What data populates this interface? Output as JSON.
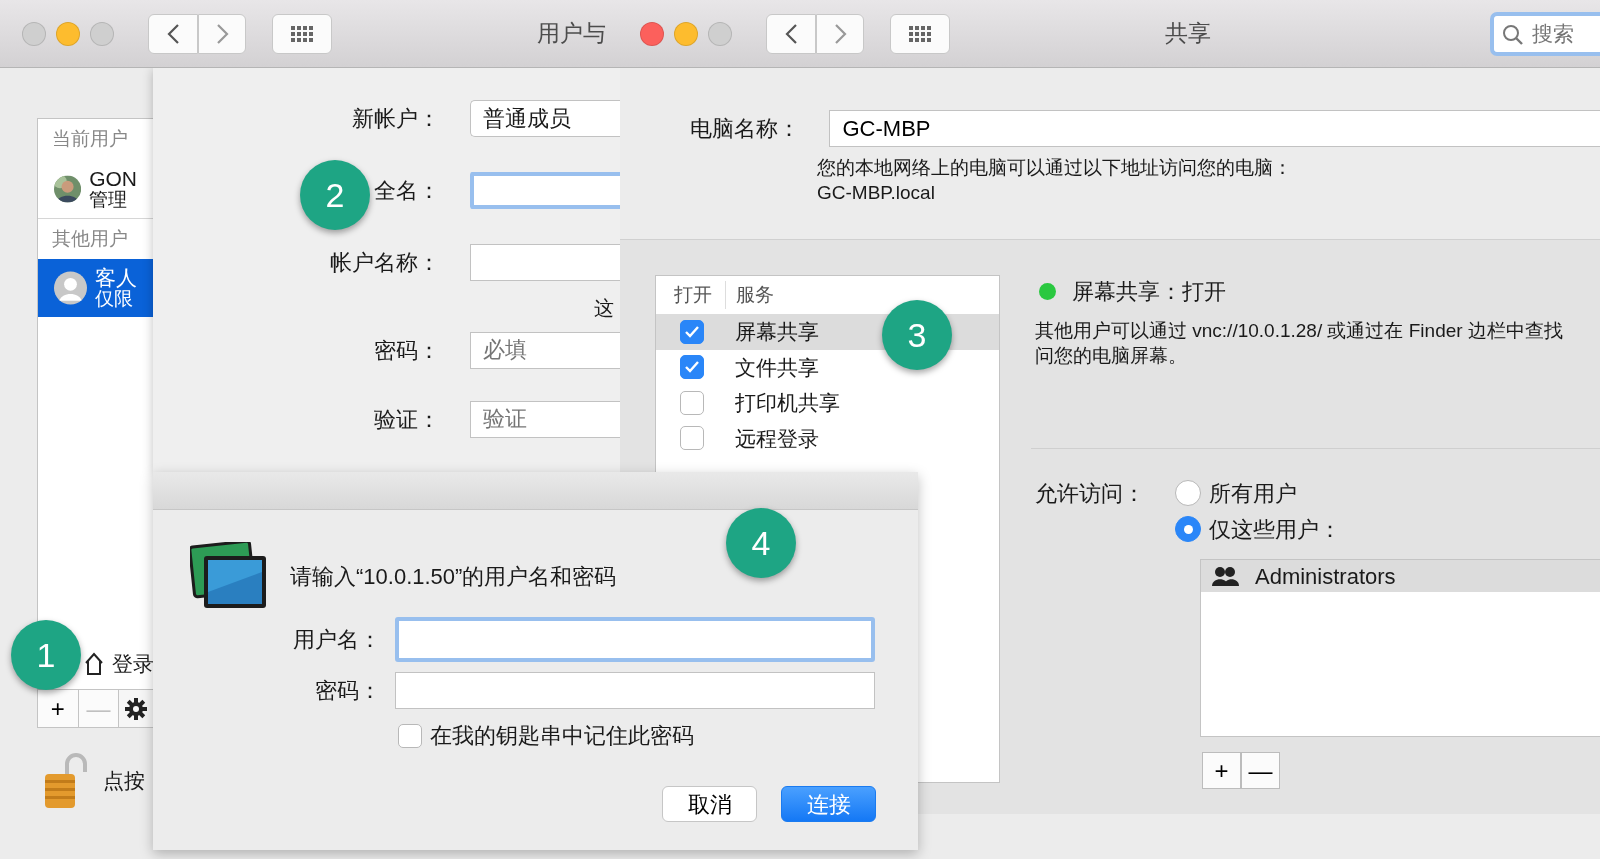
{
  "users_window": {
    "title": "用户与",
    "traffic_lights": [
      {
        "color": "#cfcfcf"
      },
      {
        "color": "#fdbc2e"
      },
      {
        "color": "#cfcfcf"
      }
    ],
    "sidebar": {
      "sections": [
        {
          "header": "当前用户",
          "users": [
            {
              "name": "GON",
              "role": "管理",
              "kind": "photo",
              "selected": false
            }
          ]
        },
        {
          "header": "其他用户",
          "users": [
            {
              "name": "客人",
              "role": "仅限",
              "kind": "generic",
              "selected": true
            }
          ]
        }
      ],
      "login_item": "登录",
      "buttons": [
        {
          "label": "+",
          "disabled": false
        },
        {
          "label": "—",
          "disabled": true
        }
      ]
    },
    "lock_text": "点按",
    "sheet": {
      "fields": [
        {
          "label": "新帐户：",
          "kind": "popup",
          "value": "普通成员"
        },
        {
          "label": "全名：",
          "kind": "text",
          "focused": true
        },
        {
          "label": "帐户名称：",
          "kind": "text",
          "focused": false,
          "note": "这"
        },
        {
          "label": "密码：",
          "kind": "text",
          "focused": false,
          "placeholder": "必填"
        },
        {
          "label": "验证：",
          "kind": "text",
          "focused": false,
          "placeholder": "验证"
        }
      ]
    }
  },
  "sharing_window": {
    "title": "共享",
    "traffic_lights": [
      {
        "color": "#fc605c"
      },
      {
        "color": "#fdbc2e"
      },
      {
        "color": "#cfcfcf"
      }
    ],
    "search": {
      "placeholder": "搜索"
    },
    "computer_name": {
      "label": "电脑名称：",
      "value": "GC-MBP",
      "note": "您的本地网络上的电脑可以通过以下地址访问您的电脑：",
      "address": "GC-MBP.local"
    },
    "services": {
      "columns": [
        "打开",
        "服务"
      ],
      "rows": [
        {
          "name": "屏幕共享",
          "checked": true,
          "selected": true
        },
        {
          "name": "文件共享",
          "checked": true,
          "selected": false
        },
        {
          "name": "打印机共享",
          "checked": false,
          "selected": false
        },
        {
          "name": "远程登录",
          "checked": false,
          "selected": false
        }
      ]
    },
    "status": {
      "title": "屏幕共享：打开",
      "color": "#2ac840",
      "lines": [
        "其他用户可以通过 vnc://10.0.1.28/ 或通过在 Finder 边栏中查找",
        "问您的电脑屏幕。"
      ]
    },
    "access": {
      "label": "允许访问：",
      "options": [
        {
          "label": "所有用户",
          "selected": false
        },
        {
          "label": "仅这些用户：",
          "selected": true
        }
      ],
      "users": [
        {
          "name": "Administrators",
          "selected": true
        }
      ],
      "buttons": [
        "+",
        "—"
      ]
    }
  },
  "connect_dialog": {
    "prompt": "请输入“10.0.1.50”的用户名和密码",
    "fields": [
      {
        "label": "用户名：",
        "focused": true
      },
      {
        "label": "密码：",
        "focused": false
      }
    ],
    "remember": {
      "label": "在我的钥匙串中记住此密码",
      "checked": false
    },
    "buttons": [
      {
        "label": "取消",
        "default": false
      },
      {
        "label": "连接",
        "default": true
      }
    ]
  },
  "callouts": [
    {
      "label": "1"
    },
    {
      "label": "2"
    },
    {
      "label": "3"
    },
    {
      "label": "4"
    }
  ]
}
